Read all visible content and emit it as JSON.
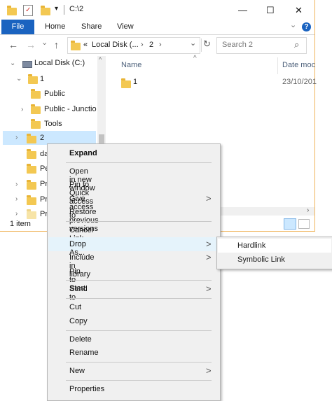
{
  "window": {
    "path_title": "C:\\2",
    "controls": {
      "minimize": "—",
      "maximize": "☐",
      "close": "✕"
    },
    "quick_access_arrow": "▾"
  },
  "ribbon": {
    "tabs": [
      "File",
      "Home",
      "Share",
      "View"
    ],
    "expand": "⌄",
    "help": "?",
    "file_tab_color": "#1a63c0"
  },
  "nav": {
    "back": "←",
    "forward": "→",
    "dropdown": "⌄",
    "up": "↑",
    "breadcrumb": [
      "«",
      "Local Disk (...",
      "›",
      "2",
      "›"
    ],
    "address_dropdown": "⌄",
    "refresh": "↻",
    "search_placeholder": "Search 2",
    "search_icon": "⌕"
  },
  "tree": {
    "items": [
      {
        "label": "Local Disk (C:)"
      },
      {
        "label": "1"
      },
      {
        "label": "Public"
      },
      {
        "label": "Public - Junctio"
      },
      {
        "label": "Tools"
      },
      {
        "label": "2"
      },
      {
        "label": "da"
      },
      {
        "label": "Pe"
      },
      {
        "label": "Pr"
      },
      {
        "label": "Pr"
      },
      {
        "label": "Pr"
      }
    ]
  },
  "file_list": {
    "columns": [
      "Name",
      "Date moc"
    ],
    "sort_indicator": "^",
    "rows": [
      {
        "name": "1",
        "date": "23/10/201"
      }
    ]
  },
  "status": {
    "count": "1 item"
  },
  "context_menu": {
    "groups": [
      [
        "Expand"
      ],
      [
        "Open in new window",
        "Pin to Quick access",
        "Give access to",
        "Restore previous versions"
      ],
      [
        "Cancel Link Creation",
        "Drop As...",
        "Include in library",
        "Pin to Start"
      ],
      [
        "Send to"
      ],
      [
        "Cut",
        "Copy"
      ],
      [
        "Delete",
        "Rename"
      ],
      [
        "New"
      ],
      [
        "Properties"
      ]
    ],
    "submenu_arrow": ">"
  },
  "submenu": {
    "items": [
      "Hardlink",
      "Symbolic Link"
    ]
  },
  "colors": {
    "selection": "#cce8ff",
    "hover": "#e5f3fb",
    "border": "#f5a623"
  }
}
